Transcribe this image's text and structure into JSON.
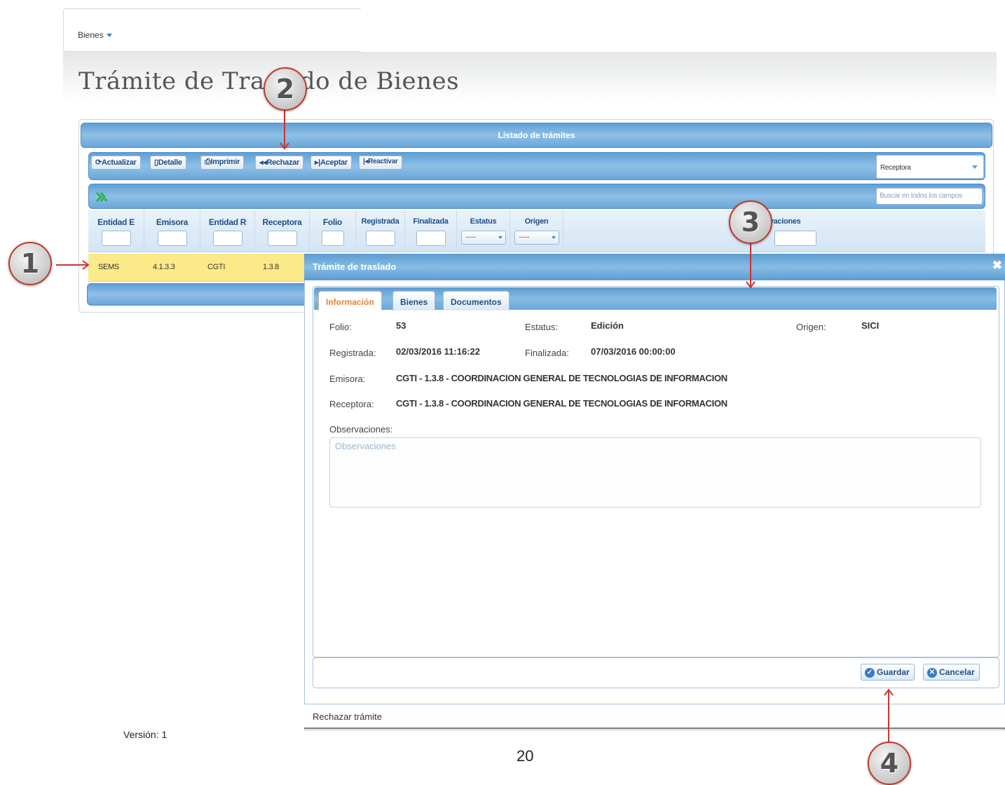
{
  "nav": {
    "menu_label": "Bienes"
  },
  "page_title": "Trámite de Traslado de Bienes",
  "grid": {
    "header": "Listado de trámites",
    "toolbar": {
      "refresh": "Actualizar",
      "detail": "Detalle",
      "print": "Imprimir",
      "reject": "Rechazar",
      "accept": "Aceptar",
      "reactivate": "Reactivar"
    },
    "filter_select": "Receptora",
    "search_placeholder": "Buscar en todos los campos",
    "columns": [
      "Entidad E",
      "Emisora",
      "Entidad R",
      "Receptora",
      "Folio",
      "Registrada",
      "Finalizada",
      "Estatus",
      "Origen",
      "Observaciones"
    ],
    "dropdown_filter_value": "-----",
    "rows": [
      {
        "entidad_e": "SEMS",
        "emisora": "4.1.3.3",
        "entidad_r": "CGTI",
        "receptora": "1.3.8"
      }
    ]
  },
  "dialog": {
    "title": "Trámite de traslado",
    "close_icon": "close-icon",
    "tabs": [
      "Información",
      "Bienes",
      "Documentos"
    ],
    "active_tab": "Información",
    "fields": {
      "folio_label": "Folio:",
      "folio": "53",
      "estatus_label": "Estatus:",
      "estatus": "Edición",
      "origen_label": "Origen:",
      "origen": "SICI",
      "registrada_label": "Registrada:",
      "registrada": "02/03/2016 11:16:22",
      "finalizada_label": "Finalizada:",
      "finalizada": "07/03/2016 00:00:00",
      "emisora_label": "Emisora:",
      "emisora": "CGTI - 1.3.8 - COORDINACION GENERAL DE TECNOLOGIAS DE INFORMACION",
      "receptora_label": "Receptora:",
      "receptora": "CGTI - 1.3.8 - COORDINACION GENERAL DE TECNOLOGIAS DE INFORMACION",
      "observaciones_label": "Observaciones:",
      "observaciones_placeholder": "Observaciones"
    },
    "buttons": {
      "save": "Guardar",
      "cancel": "Cancelar"
    },
    "status": "Rechazar trámite"
  },
  "callouts": [
    "1",
    "2",
    "3",
    "4"
  ],
  "footer": {
    "version": "Versión: 1",
    "page_number": "20"
  },
  "colors": {
    "accent_blue": "#5f9fd6",
    "selected_row": "#fbe98a",
    "active_tab_text": "#e8813a",
    "callout_border": "#c0392b"
  }
}
